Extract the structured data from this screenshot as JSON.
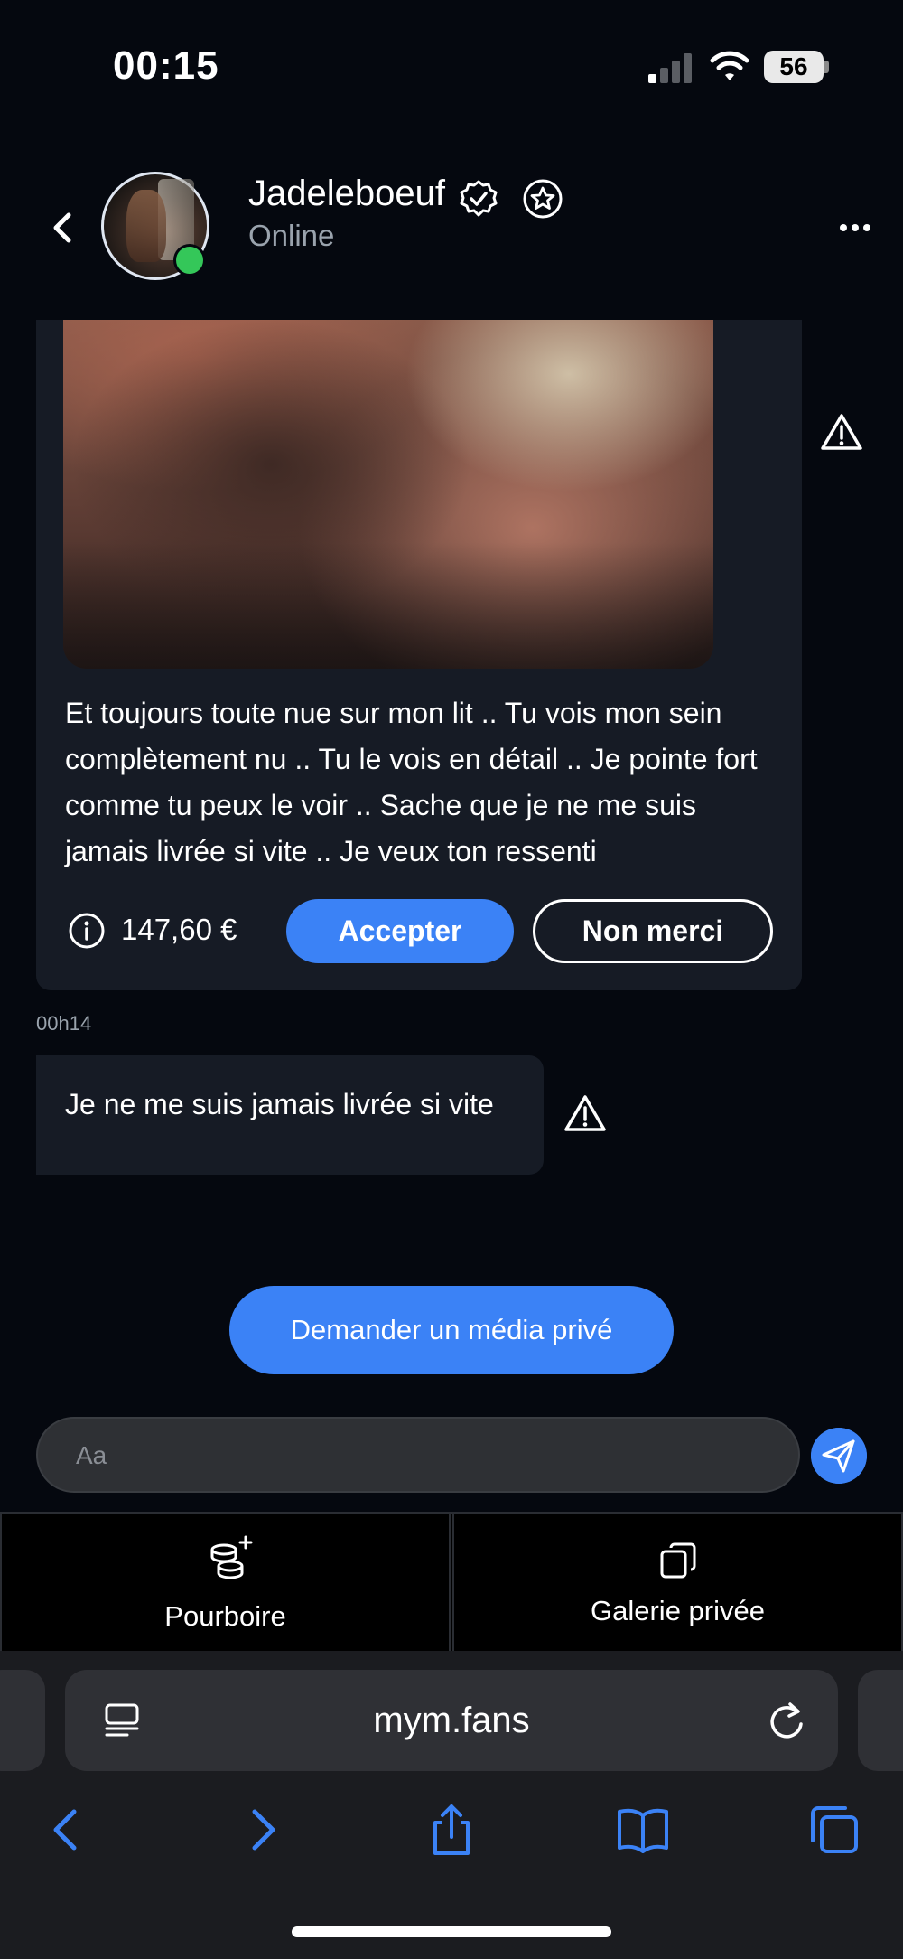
{
  "status_bar": {
    "time": "00:15",
    "battery": "56"
  },
  "header": {
    "username": "Jadeleboeuf",
    "status": "Online",
    "icons": [
      "back-chevron-icon",
      "verified-badge-icon",
      "star-badge-icon",
      "more-dots-icon"
    ]
  },
  "offer_message": {
    "text": "Et toujours toute nue sur mon lit .. Tu vois mon sein complètement nu .. Tu le vois en détail .. Je pointe fort comme tu peux le voir .. Sache que je ne me suis jamais livrée si vite .. Je veux ton ressenti",
    "price": "147,60 €",
    "accept_label": "Accepter",
    "decline_label": "Non merci"
  },
  "timestamp": "00h14",
  "message": {
    "text": "Je ne me suis jamais livrée si vite"
  },
  "request_button": "Demander un média privé",
  "composer": {
    "placeholder": "Aa"
  },
  "tabs": [
    {
      "label": "Pourboire",
      "icon": "coins-plus-icon"
    },
    {
      "label": "Galerie privée",
      "icon": "gallery-copy-icon"
    }
  ],
  "browser": {
    "url": "mym.fans",
    "toolbar_icons": [
      "back-icon",
      "forward-icon",
      "share-icon",
      "bookmarks-icon",
      "tabs-icon"
    ]
  },
  "colors": {
    "accent": "#3b82f6",
    "online": "#34c759",
    "background": "#05080f",
    "card": "#161b25"
  }
}
